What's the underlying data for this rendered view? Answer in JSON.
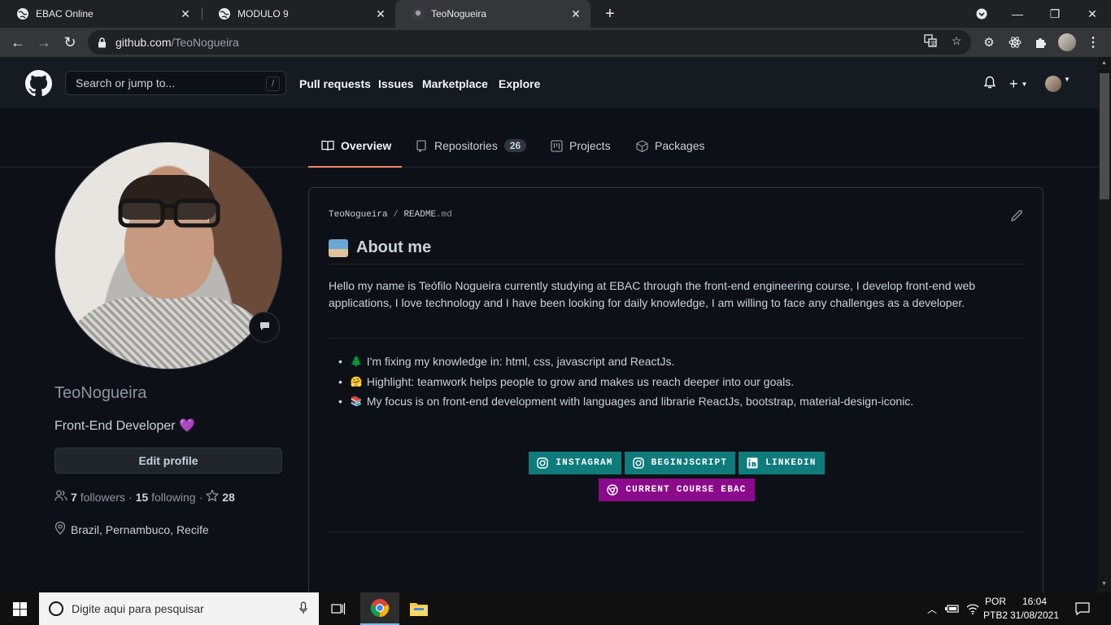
{
  "browser": {
    "tabs": [
      {
        "title": "EBAC Online",
        "active": false
      },
      {
        "title": "MODULO 9",
        "active": false
      },
      {
        "title": "TeoNogueira",
        "active": true
      }
    ],
    "url_host": "github.com",
    "url_path": "/TeoNogueira"
  },
  "github": {
    "search_placeholder": "Search or jump to...",
    "search_shortcut": "/",
    "nav": [
      "Pull requests",
      "Issues",
      "Marketplace",
      "Explore"
    ],
    "profile_tabs": [
      {
        "label": "Overview",
        "active": true,
        "icon": "book-icon"
      },
      {
        "label": "Repositories",
        "count": "26",
        "icon": "repo-icon"
      },
      {
        "label": "Projects",
        "icon": "project-icon"
      },
      {
        "label": "Packages",
        "icon": "package-icon"
      }
    ]
  },
  "profile": {
    "username": "TeoNogueira",
    "bio": "Front-End Developer",
    "bio_emoji": "💜",
    "edit_label": "Edit profile",
    "followers_count": "7",
    "followers_label": "followers",
    "following_count": "15",
    "following_label": "following",
    "stars_count": "28",
    "location": "Brazil, Pernambuco, Recife"
  },
  "readme": {
    "owner": "TeoNogueira",
    "separator": "/",
    "file_name": "README",
    "file_ext": ".md",
    "heading": "About me",
    "intro": "Hello my name is Teófilo Nogueira currently studying at EBAC through the front-end engineering course, I develop front-end web applications, I love technology and I have been looking for daily knowledge, I am willing to face any challenges as a developer.",
    "items": [
      {
        "emoji": "🌲",
        "text": "I'm fixing my knowledge in: html, css, javascript and ReactJs."
      },
      {
        "emoji": "🤗",
        "text": "Highlight: teamwork helps people to grow and makes us reach deeper into our goals."
      },
      {
        "emoji": "📚",
        "text": "My focus is on front-end development with languages and librarie ReactJs, bootstrap, material-design-iconic."
      }
    ],
    "badges_row1": [
      {
        "label": "INSTAGRAM",
        "color": "#0f7b7b",
        "icon": "instagram-icon"
      },
      {
        "label": "BEGINJSCRIPT",
        "color": "#0f7b7b",
        "icon": "instagram-icon"
      },
      {
        "label": "LINKEDIN",
        "color": "#0f7b7b",
        "icon": "linkedin-icon"
      }
    ],
    "badges_row2": [
      {
        "label": "CURRENT COURSE EBAC",
        "color": "#8b0a8b",
        "icon": "chrome-icon"
      }
    ]
  },
  "taskbar": {
    "search_placeholder": "Digite aqui para pesquisar",
    "lang_top": "POR",
    "lang_bottom": "PTB2",
    "time": "16:04",
    "date": "31/08/2021"
  },
  "colors": {
    "accent_underline": "#f78166",
    "badge_teal": "#0f7b7b",
    "badge_purple": "#8b0a8b",
    "page_bg": "#0d1117"
  }
}
